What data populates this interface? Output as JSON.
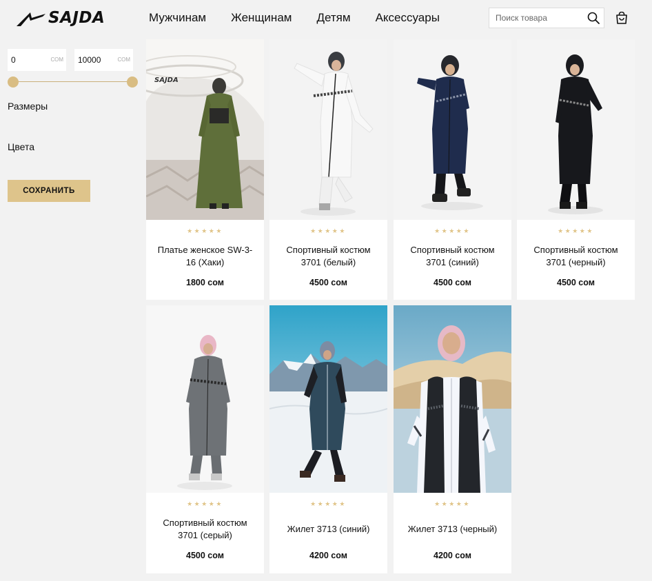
{
  "brand": {
    "name": "SAJDA"
  },
  "nav": {
    "items": [
      "Мужчинам",
      "Женщинам",
      "Детям",
      "Аксессуары"
    ]
  },
  "search": {
    "placeholder": "Поиск товара"
  },
  "filters": {
    "price_min": "0",
    "price_max": "10000",
    "currency": "сом",
    "sizes_label": "Размеры",
    "colors_label": "Цвета",
    "save_label": "СОХРАНИТЬ"
  },
  "products": [
    {
      "name": "Платье женское SW-3-16 (Хаки)",
      "price": "1800 сом",
      "stars": "★★★★★"
    },
    {
      "name": "Спортивный костюм 3701 (белый)",
      "price": "4500 сом",
      "stars": "★★★★★"
    },
    {
      "name": "Спортивный костюм 3701 (синий)",
      "price": "4500 сом",
      "stars": "★★★★★"
    },
    {
      "name": "Спортивный костюм 3701 (черный)",
      "price": "4500 сом",
      "stars": "★★★★★"
    },
    {
      "name": "Спортивный костюм 3701 (серый)",
      "price": "4500 сом",
      "stars": "★★★★★"
    },
    {
      "name": "Жилет 3713 (синий)",
      "price": "4200 сом",
      "stars": "★★★★★"
    },
    {
      "name": "Жилет 3713 (черный)",
      "price": "4200 сом",
      "stars": "★★★★★"
    }
  ],
  "colors": {
    "accent": "#dec48b",
    "star": "#e0c488",
    "background": "#f2f2f2"
  }
}
